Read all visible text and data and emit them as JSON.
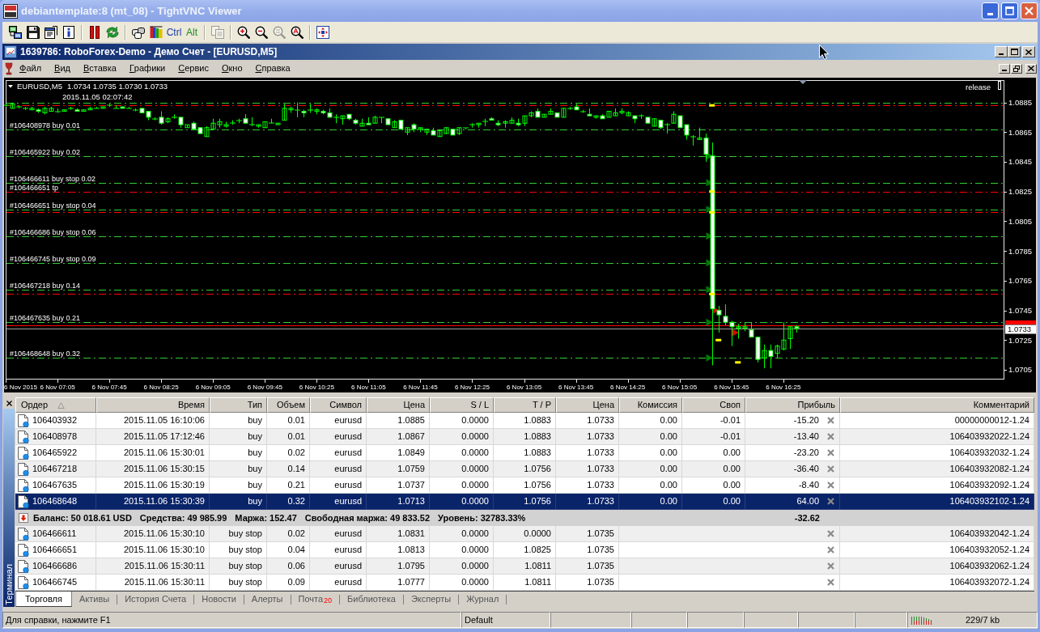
{
  "vnc_window": {
    "title": "debiantemplate:8 (mt_08) - TightVNC Viewer"
  },
  "vnc_toolbar": [
    [
      {
        "disabled": false
      },
      {
        "disabled": false
      },
      {
        "disabled": false
      },
      {
        "disabled": false
      }
    ],
    [
      {
        "disabled": false
      },
      {
        "disabled": false
      }
    ],
    [
      {
        "disabled": false
      },
      {
        "disabled": false
      },
      {
        "label": "Ctrl",
        "color": "#1a3ca8"
      },
      {
        "label": "Alt",
        "color": "#1e8a1e"
      }
    ],
    [
      {
        "disabled": true
      }
    ],
    [
      {
        "disabled": false
      },
      {
        "disabled": false
      },
      {
        "disabled": true
      },
      {
        "disabled": false
      }
    ],
    [
      {
        "disabled": false
      }
    ]
  ],
  "mt4_window": {
    "title": "1639786: RoboForex-Demo - Демо Счет - [EURUSD,M5]"
  },
  "menu": [
    "Файл",
    "Вид",
    "Вставка",
    "Графики",
    "Сервис",
    "Окно",
    "Справка"
  ],
  "chart": {
    "symbol": "EURUSD,M5",
    "quote": "1.0734 1.0735 1.0730 1.0733",
    "info": "2015.11.05 02:07:42",
    "expert": "release",
    "chart_data": {
      "type": "candlestick",
      "color": "#00ff00",
      "x": [
        "2015-11-06T06:25",
        "2015-11-06T06:30",
        "2015-11-06T06:35",
        "2015-11-06T06:40",
        "2015-11-06T06:45",
        "2015-11-06T06:50",
        "2015-11-06T06:55",
        "2015-11-06T07:00",
        "2015-11-06T07:05",
        "2015-11-06T07:10",
        "2015-11-06T07:15",
        "2015-11-06T07:20",
        "2015-11-06T07:25",
        "2015-11-06T07:30",
        "2015-11-06T07:35",
        "2015-11-06T07:40",
        "2015-11-06T07:45",
        "2015-11-06T07:50",
        "2015-11-06T07:55",
        "2015-11-06T08:00",
        "2015-11-06T08:05",
        "2015-11-06T08:10",
        "2015-11-06T08:15",
        "2015-11-06T08:20",
        "2015-11-06T08:25",
        "2015-11-06T08:30",
        "2015-11-06T08:35",
        "2015-11-06T08:40",
        "2015-11-06T08:45",
        "2015-11-06T08:50",
        "2015-11-06T08:55",
        "2015-11-06T09:00",
        "2015-11-06T09:05",
        "2015-11-06T09:10",
        "2015-11-06T09:15",
        "2015-11-06T09:20",
        "2015-11-06T09:25",
        "2015-11-06T09:30",
        "2015-11-06T09:35",
        "2015-11-06T09:40",
        "2015-11-06T09:45",
        "2015-11-06T09:50",
        "2015-11-06T09:55",
        "2015-11-06T10:00",
        "2015-11-06T10:05",
        "2015-11-06T10:10",
        "2015-11-06T10:15",
        "2015-11-06T10:20",
        "2015-11-06T10:25",
        "2015-11-06T10:30",
        "2015-11-06T10:35",
        "2015-11-06T10:40",
        "2015-11-06T10:45",
        "2015-11-06T10:50",
        "2015-11-06T10:55",
        "2015-11-06T11:00",
        "2015-11-06T11:05",
        "2015-11-06T11:10",
        "2015-11-06T11:15",
        "2015-11-06T11:20",
        "2015-11-06T11:25",
        "2015-11-06T11:30",
        "2015-11-06T11:35",
        "2015-11-06T11:40",
        "2015-11-06T11:45",
        "2015-11-06T11:50",
        "2015-11-06T11:55",
        "2015-11-06T12:00",
        "2015-11-06T12:05",
        "2015-11-06T12:10",
        "2015-11-06T12:15",
        "2015-11-06T12:20",
        "2015-11-06T12:25",
        "2015-11-06T12:30",
        "2015-11-06T12:35",
        "2015-11-06T12:40",
        "2015-11-06T12:45",
        "2015-11-06T12:50",
        "2015-11-06T12:55",
        "2015-11-06T13:00",
        "2015-11-06T13:05",
        "2015-11-06T13:10",
        "2015-11-06T13:15",
        "2015-11-06T13:20",
        "2015-11-06T13:25",
        "2015-11-06T13:30",
        "2015-11-06T13:35",
        "2015-11-06T13:40",
        "2015-11-06T13:45",
        "2015-11-06T13:50",
        "2015-11-06T13:55",
        "2015-11-06T14:00",
        "2015-11-06T14:05",
        "2015-11-06T14:10",
        "2015-11-06T14:15",
        "2015-11-06T14:20",
        "2015-11-06T14:25",
        "2015-11-06T14:30",
        "2015-11-06T14:35",
        "2015-11-06T14:40",
        "2015-11-06T14:45",
        "2015-11-06T14:50",
        "2015-11-06T14:55",
        "2015-11-06T15:00",
        "2015-11-06T15:05",
        "2015-11-06T15:10",
        "2015-11-06T15:15",
        "2015-11-06T15:20",
        "2015-11-06T15:25",
        "2015-11-06T15:30",
        "2015-11-06T15:35",
        "2015-11-06T15:40",
        "2015-11-06T15:45",
        "2015-11-06T15:50",
        "2015-11-06T15:55",
        "2015-11-06T16:00",
        "2015-11-06T16:05",
        "2015-11-06T16:10",
        "2015-11-06T16:15",
        "2015-11-06T16:20",
        "2015-11-06T16:25",
        "2015-11-06T16:30",
        "2015-11-06T16:35"
      ],
      "ohlc": [
        [
          1.0883,
          1.0884,
          1.0882,
          1.0883
        ],
        [
          1.0881,
          1.0885,
          1.0881,
          1.0884
        ],
        [
          1.0882,
          1.0883,
          1.0881,
          1.0882
        ],
        [
          1.0881,
          1.0882,
          1.088,
          1.0881
        ],
        [
          1.088,
          1.0882,
          1.088,
          1.0881
        ],
        [
          1.088,
          1.0881,
          1.0878,
          1.0879
        ],
        [
          1.0878,
          1.0882,
          1.0877,
          1.0881
        ],
        [
          1.0879,
          1.0882,
          1.0879,
          1.0881
        ],
        [
          1.0879,
          1.0881,
          1.0878,
          1.0879
        ],
        [
          1.0879,
          1.088,
          1.0879,
          1.088
        ],
        [
          1.0881,
          1.0882,
          1.088,
          1.0881
        ],
        [
          1.088,
          1.0881,
          1.0879,
          1.0879
        ],
        [
          1.0879,
          1.088,
          1.0879,
          1.088
        ],
        [
          1.088,
          1.0882,
          1.088,
          1.0881
        ],
        [
          1.0881,
          1.0882,
          1.0881,
          1.0881
        ],
        [
          1.0881,
          1.0882,
          1.0881,
          1.0882
        ],
        [
          1.0883,
          1.0884,
          1.0882,
          1.0883
        ],
        [
          1.0881,
          1.0883,
          1.0881,
          1.0881
        ],
        [
          1.0882,
          1.0882,
          1.0881,
          1.0881
        ],
        [
          1.0881,
          1.0882,
          1.0881,
          1.0881
        ],
        [
          1.088,
          1.0881,
          1.0879,
          1.088
        ],
        [
          1.0881,
          1.0881,
          1.0878,
          1.0878
        ],
        [
          1.0879,
          1.0879,
          1.0873,
          1.0875
        ],
        [
          1.0874,
          1.0875,
          1.0873,
          1.0874
        ],
        [
          1.0875,
          1.0879,
          1.087,
          1.0871
        ],
        [
          1.0872,
          1.0875,
          1.0871,
          1.0874
        ],
        [
          1.0875,
          1.0877,
          1.0874,
          1.0875
        ],
        [
          1.0875,
          1.0875,
          1.0868,
          1.087
        ],
        [
          1.0868,
          1.087,
          1.0868,
          1.087
        ],
        [
          1.0871,
          1.0872,
          1.0867,
          1.0867
        ],
        [
          1.0868,
          1.0868,
          1.0864,
          1.0864
        ],
        [
          1.0862,
          1.0869,
          1.0862,
          1.0868
        ],
        [
          1.0867,
          1.0874,
          1.0867,
          1.0871
        ],
        [
          1.087,
          1.0874,
          1.0868,
          1.0872
        ],
        [
          1.0869,
          1.0872,
          1.0868,
          1.087
        ],
        [
          1.0871,
          1.0873,
          1.087,
          1.0871
        ],
        [
          1.0873,
          1.0874,
          1.0871,
          1.0873
        ],
        [
          1.0874,
          1.0877,
          1.0871,
          1.0871
        ],
        [
          1.087,
          1.0875,
          1.0869,
          1.087
        ],
        [
          1.0869,
          1.087,
          1.0868,
          1.087
        ],
        [
          1.0868,
          1.0872,
          1.0868,
          1.0872
        ],
        [
          1.0871,
          1.0874,
          1.0871,
          1.0871
        ],
        [
          1.087,
          1.0871,
          1.087,
          1.0871
        ],
        [
          1.0873,
          1.0884,
          1.0873,
          1.0881
        ],
        [
          1.088,
          1.0882,
          1.0878,
          1.0881
        ],
        [
          1.088,
          1.0885,
          1.0875,
          1.088
        ],
        [
          1.0879,
          1.088,
          1.0875,
          1.0878
        ],
        [
          1.088,
          1.0884,
          1.0878,
          1.088
        ],
        [
          1.0879,
          1.0881,
          1.0877,
          1.088
        ],
        [
          1.0879,
          1.088,
          1.0877,
          1.0878
        ],
        [
          1.0878,
          1.0881,
          1.0875,
          1.0875
        ],
        [
          1.0875,
          1.0877,
          1.0871,
          1.0875
        ],
        [
          1.0874,
          1.0876,
          1.087,
          1.0876
        ],
        [
          1.0877,
          1.0877,
          1.0873,
          1.0874
        ],
        [
          1.0873,
          1.0874,
          1.087,
          1.0871
        ],
        [
          1.0869,
          1.0874,
          1.0869,
          1.0871
        ],
        [
          1.0871,
          1.0875,
          1.087,
          1.087
        ],
        [
          1.0871,
          1.0876,
          1.0871,
          1.0875
        ],
        [
          1.0875,
          1.0875,
          1.0871,
          1.0875
        ],
        [
          1.0874,
          1.0874,
          1.087,
          1.087
        ],
        [
          1.0868,
          1.0873,
          1.0868,
          1.0872
        ],
        [
          1.0873,
          1.0873,
          1.0867,
          1.0867
        ],
        [
          1.0865,
          1.0868,
          1.0863,
          1.0868
        ],
        [
          1.087,
          1.0871,
          1.0865,
          1.0867
        ],
        [
          1.0867,
          1.0868,
          1.0865,
          1.0868
        ],
        [
          1.0865,
          1.0867,
          1.0863,
          1.0867
        ],
        [
          1.0866,
          1.0868,
          1.0863,
          1.0863
        ],
        [
          1.0862,
          1.0867,
          1.0862,
          1.0866
        ],
        [
          1.0864,
          1.0868,
          1.0864,
          1.0868
        ],
        [
          1.0867,
          1.0867,
          1.0863,
          1.0863
        ],
        [
          1.0864,
          1.0868,
          1.0863,
          1.0868
        ],
        [
          1.0868,
          1.0868,
          1.0867,
          1.0868
        ],
        [
          1.087,
          1.0871,
          1.0868,
          1.087
        ],
        [
          1.087,
          1.0871,
          1.0868,
          1.0871
        ],
        [
          1.0872,
          1.0874,
          1.0869,
          1.0872
        ],
        [
          1.0874,
          1.0875,
          1.0873,
          1.0873
        ],
        [
          1.0871,
          1.0873,
          1.0869,
          1.087
        ],
        [
          1.0871,
          1.0873,
          1.0868,
          1.0872
        ],
        [
          1.0871,
          1.0875,
          1.0871,
          1.0873
        ],
        [
          1.0871,
          1.0874,
          1.0869,
          1.087
        ],
        [
          1.0871,
          1.0876,
          1.0869,
          1.0876
        ],
        [
          1.0876,
          1.0879,
          1.0875,
          1.0878
        ],
        [
          1.0879,
          1.0881,
          1.0875,
          1.0875
        ],
        [
          1.0875,
          1.0877,
          1.0875,
          1.0877
        ],
        [
          1.0877,
          1.0881,
          1.0877,
          1.0879
        ],
        [
          1.0878,
          1.0878,
          1.0875,
          1.0875
        ],
        [
          1.0875,
          1.0881,
          1.0875,
          1.0881
        ],
        [
          1.0881,
          1.0882,
          1.088,
          1.0881
        ],
        [
          1.0882,
          1.0884,
          1.088,
          1.088
        ],
        [
          1.0879,
          1.088,
          1.0878,
          1.0879
        ],
        [
          1.0877,
          1.0881,
          1.0876,
          1.0876
        ],
        [
          1.0875,
          1.0876,
          1.0874,
          1.0876
        ],
        [
          1.0876,
          1.0877,
          1.0874,
          1.0874
        ],
        [
          1.0875,
          1.0879,
          1.0875,
          1.0879
        ],
        [
          1.0876,
          1.0881,
          1.0876,
          1.0878
        ],
        [
          1.0878,
          1.0881,
          1.0877,
          1.0879
        ],
        [
          1.0876,
          1.0879,
          1.0876,
          1.0878
        ],
        [
          1.0876,
          1.0876,
          1.0871,
          1.0874
        ],
        [
          1.0876,
          1.0877,
          1.0874,
          1.0876
        ],
        [
          1.0875,
          1.0875,
          1.0871,
          1.0871
        ],
        [
          1.0869,
          1.0874,
          1.0869,
          1.0874
        ],
        [
          1.0873,
          1.0873,
          1.0867,
          1.0868
        ],
        [
          1.087,
          1.0871,
          1.0864,
          1.087
        ],
        [
          1.0871,
          1.0879,
          1.0871,
          1.0877
        ],
        [
          1.0876,
          1.0876,
          1.0868,
          1.0868
        ],
        [
          1.087,
          1.087,
          1.086,
          1.0863
        ],
        [
          1.0862,
          1.0863,
          1.0856,
          1.0862
        ],
        [
          1.086,
          1.0868,
          1.086,
          1.0861
        ],
        [
          1.0861,
          1.0864,
          1.0845,
          1.085
        ],
        [
          1.0849,
          1.0858,
          1.0708,
          1.0746
        ],
        [
          1.0745,
          1.0748,
          1.073,
          1.0742
        ],
        [
          1.0741,
          1.0749,
          1.0735,
          1.0737
        ],
        [
          1.0737,
          1.0738,
          1.0721,
          1.0734
        ],
        [
          1.0733,
          1.0736,
          1.0726,
          1.0734
        ],
        [
          1.0733,
          1.0737,
          1.0731,
          1.0734
        ],
        [
          1.0732,
          1.0737,
          1.0727,
          1.0727
        ],
        [
          1.0727,
          1.0727,
          1.071,
          1.0712
        ],
        [
          1.0713,
          1.0722,
          1.0706,
          1.0718
        ],
        [
          1.0718,
          1.0722,
          1.0706,
          1.0714
        ],
        [
          1.0716,
          1.0722,
          1.0713,
          1.0721
        ],
        [
          1.0719,
          1.0737,
          1.0718,
          1.0725
        ],
        [
          1.0726,
          1.0734,
          1.0719,
          1.0734
        ],
        [
          1.0734,
          1.0735,
          1.073,
          1.0733
        ]
      ],
      "series": [
        {
          "type": "scatter",
          "marker": "triangle",
          "color": "#007a00",
          "x": [
            "2015-11-06T15:28",
            "2015-11-06T15:28",
            "2015-11-06T15:28",
            "2015-11-06T15:28",
            "2015-11-06T15:28",
            "2015-11-06T15:28",
            "2015-11-06T15:28",
            "2015-11-06T15:28"
          ],
          "values": [
            1.0849,
            1.0831,
            1.0813,
            1.0795,
            1.0777,
            1.0759,
            1.0737,
            1.0713
          ]
        },
        {
          "type": "scatter",
          "marker": "triangle",
          "color": "#e00000",
          "x": [
            "2015-11-06T15:33",
            "2015-11-06T15:48"
          ],
          "values": [
            1.0745,
            1.073
          ]
        },
        {
          "type": "scatter",
          "marker": "square",
          "color": "#ffff00",
          "x": [
            "2015-11-06T15:30",
            "2015-11-06T15:30",
            "2015-11-06T15:30",
            "2015-11-06T15:30",
            "2015-11-06T15:35",
            "2015-11-06T15:50"
          ],
          "values": [
            1.0883,
            1.0825,
            1.0811,
            1.0756,
            1.0725,
            1.071
          ]
        }
      ],
      "xlim": [
        "2015-11-06T06:25",
        "2015-11-06T19:15"
      ],
      "ylim": [
        1.0699,
        1.09
      ],
      "xticks": [
        {
          "value": "2015-11-06T06:25",
          "label": "6 Nov 2015"
        },
        {
          "value": "2015-11-06T07:05",
          "label": "6 Nov 07:05"
        },
        {
          "value": "2015-11-06T07:45",
          "label": "6 Nov 07:45"
        },
        {
          "value": "2015-11-06T08:25",
          "label": "6 Nov 08:25"
        },
        {
          "value": "2015-11-06T09:05",
          "label": "6 Nov 09:05"
        },
        {
          "value": "2015-11-06T09:45",
          "label": "6 Nov 09:45"
        },
        {
          "value": "2015-11-06T10:25",
          "label": "6 Nov 10:25"
        },
        {
          "value": "2015-11-06T11:05",
          "label": "6 Nov 11:05"
        },
        {
          "value": "2015-11-06T11:45",
          "label": "6 Nov 11:45"
        },
        {
          "value": "2015-11-06T12:25",
          "label": "6 Nov 12:25"
        },
        {
          "value": "2015-11-06T13:05",
          "label": "6 Nov 13:05"
        },
        {
          "value": "2015-11-06T13:45",
          "label": "6 Nov 13:45"
        },
        {
          "value": "2015-11-06T14:25",
          "label": "6 Nov 14:25"
        },
        {
          "value": "2015-11-06T15:05",
          "label": "6 Nov 15:05"
        },
        {
          "value": "2015-11-06T15:45",
          "label": "6 Nov 15:45"
        },
        {
          "value": "2015-11-06T16:25",
          "label": "6 Nov 16:25"
        }
      ],
      "yticks": [
        1.0885,
        1.0865,
        1.0845,
        1.0825,
        1.0805,
        1.0785,
        1.0765,
        1.0745,
        1.0725,
        1.0705
      ],
      "ref_lines": [
        {
          "axis": "y",
          "value": 1.0885,
          "color": "#32cd32",
          "line_style": "dashdot"
        },
        {
          "axis": "y",
          "value": 1.0883,
          "color": "#ff0000",
          "line_style": "dashdot"
        },
        {
          "axis": "y",
          "value": 1.0867,
          "label": "#106408978 buy 0.01",
          "color": "#32cd32",
          "line_style": "dashdot"
        },
        {
          "axis": "y",
          "value": 1.0849,
          "label": "#106465922 buy 0.02",
          "color": "#32cd32",
          "line_style": "dashdot"
        },
        {
          "axis": "y",
          "value": 1.0831,
          "label": "#106466611 buy stop 0.02",
          "color": "#32cd32",
          "line_style": "dashdot"
        },
        {
          "axis": "y",
          "value": 1.0825,
          "label": "#106466651 tp",
          "color": "#ff0000",
          "line_style": "dashdot"
        },
        {
          "axis": "y",
          "value": 1.0813,
          "label": "#106466651 buy stop 0.04",
          "color": "#32cd32",
          "line_style": "dashdot"
        },
        {
          "axis": "y",
          "value": 1.0811,
          "color": "#ff0000",
          "line_style": "dashdot"
        },
        {
          "axis": "y",
          "value": 1.0795,
          "label": "#106466686 buy stop 0.06",
          "color": "#32cd32",
          "line_style": "dashdot"
        },
        {
          "axis": "y",
          "value": 1.0777,
          "label": "#106466745 buy stop 0.09",
          "color": "#32cd32",
          "line_style": "dashdot"
        },
        {
          "axis": "y",
          "value": 1.0759,
          "label": "#106467218 buy 0.14",
          "color": "#32cd32",
          "line_style": "dashdot"
        },
        {
          "axis": "y",
          "value": 1.0756,
          "color": "#ff0000",
          "line_style": "dashdot"
        },
        {
          "axis": "y",
          "value": 1.0737,
          "label": "#106467635 buy 0.21",
          "color": "#32cd32",
          "line_style": "dashdot"
        },
        {
          "axis": "y",
          "value": 1.0735,
          "color": "#ff0000",
          "line_style": "solid"
        },
        {
          "axis": "y",
          "value": 1.0733,
          "label": "1.0733",
          "color": "#a0a0a0",
          "line_style": "solid"
        },
        {
          "axis": "y",
          "value": 1.0713,
          "label": "#106468648 buy 0.32",
          "color": "#32cd32",
          "line_style": "dashdot"
        }
      ]
    }
  },
  "terminal": {
    "title": "Терминал",
    "columns": [
      {
        "label": "Ордер",
        "sorted": true
      },
      {
        "label": "Время",
        "sorted": false
      },
      {
        "label": "Тип",
        "sorted": false
      },
      {
        "label": "Объем",
        "sorted": false
      },
      {
        "label": "Символ",
        "sorted": false
      },
      {
        "label": "Цена",
        "sorted": false
      },
      {
        "label": "S / L",
        "sorted": false
      },
      {
        "label": "T / P",
        "sorted": false
      },
      {
        "label": "Цена",
        "sorted": false
      },
      {
        "label": "Комиссия",
        "sorted": false
      },
      {
        "label": "Своп",
        "sorted": false
      },
      {
        "label": "Прибыль",
        "sorted": false
      },
      {
        "label": "Комментарий",
        "sorted": false
      }
    ],
    "positions": [
      {
        "order": "106403932",
        "time": "2015.11.05 16:10:06",
        "type": "buy",
        "volume": "0.01",
        "symbol": "eurusd",
        "price": "1.0885",
        "sl": "0.0000",
        "tp": "1.0883",
        "current_price": "1.0733",
        "commission": "0.00",
        "swap": "-0.01",
        "profit": "-15.20",
        "comment": "00000000012-1.24",
        "selected": false
      },
      {
        "order": "106408978",
        "time": "2015.11.05 17:12:46",
        "type": "buy",
        "volume": "0.01",
        "symbol": "eurusd",
        "price": "1.0867",
        "sl": "0.0000",
        "tp": "1.0883",
        "current_price": "1.0733",
        "commission": "0.00",
        "swap": "-0.01",
        "profit": "-13.40",
        "comment": "106403932022-1.24",
        "selected": false
      },
      {
        "order": "106465922",
        "time": "2015.11.06 15:30:01",
        "type": "buy",
        "volume": "0.02",
        "symbol": "eurusd",
        "price": "1.0849",
        "sl": "0.0000",
        "tp": "1.0883",
        "current_price": "1.0733",
        "commission": "0.00",
        "swap": "0.00",
        "profit": "-23.20",
        "comment": "106403932032-1.24",
        "selected": false
      },
      {
        "order": "106467218",
        "time": "2015.11.06 15:30:15",
        "type": "buy",
        "volume": "0.14",
        "symbol": "eurusd",
        "price": "1.0759",
        "sl": "0.0000",
        "tp": "1.0756",
        "current_price": "1.0733",
        "commission": "0.00",
        "swap": "0.00",
        "profit": "-36.40",
        "comment": "106403932082-1.24",
        "selected": false
      },
      {
        "order": "106467635",
        "time": "2015.11.06 15:30:19",
        "type": "buy",
        "volume": "0.21",
        "symbol": "eurusd",
        "price": "1.0737",
        "sl": "0.0000",
        "tp": "1.0756",
        "current_price": "1.0733",
        "commission": "0.00",
        "swap": "0.00",
        "profit": "-8.40",
        "comment": "106403932092-1.24",
        "selected": false
      },
      {
        "order": "106468648",
        "time": "2015.11.06 15:30:39",
        "type": "buy",
        "volume": "0.32",
        "symbol": "eurusd",
        "price": "1.0713",
        "sl": "0.0000",
        "tp": "1.0756",
        "current_price": "1.0733",
        "commission": "0.00",
        "swap": "0.00",
        "profit": "64.00",
        "comment": "106403932102-1.24",
        "selected": true
      }
    ],
    "summary": {
      "items": [
        "Баланс: 50 018.61 USD",
        "Средства: 49 985.99",
        "Маржа: 152.47",
        "Свободная маржа: 49 833.52",
        "Уровень: 32783.33%"
      ],
      "profit": "-32.62"
    },
    "orders": [
      {
        "order": "106466611",
        "time": "2015.11.06 15:30:10",
        "type": "buy stop",
        "volume": "0.02",
        "symbol": "eurusd",
        "price": "1.0831",
        "sl": "0.0000",
        "tp": "0.0000",
        "current_price": "1.0735",
        "comment": "106403932042-1.24",
        "selected": false
      },
      {
        "order": "106466651",
        "time": "2015.11.06 15:30:10",
        "type": "buy stop",
        "volume": "0.04",
        "symbol": "eurusd",
        "price": "1.0813",
        "sl": "0.0000",
        "tp": "1.0825",
        "current_price": "1.0735",
        "comment": "106403932052-1.24",
        "selected": false
      },
      {
        "order": "106466686",
        "time": "2015.11.06 15:30:11",
        "type": "buy stop",
        "volume": "0.06",
        "symbol": "eurusd",
        "price": "1.0795",
        "sl": "0.0000",
        "tp": "1.0811",
        "current_price": "1.0735",
        "comment": "106403932062-1.24",
        "selected": false
      },
      {
        "order": "106466745",
        "time": "2015.11.06 15:30:11",
        "type": "buy stop",
        "volume": "0.09",
        "symbol": "eurusd",
        "price": "1.0777",
        "sl": "0.0000",
        "tp": "1.0811",
        "current_price": "1.0735",
        "comment": "106403932072-1.24",
        "selected": false
      }
    ],
    "tabs": [
      {
        "label": "Торговля",
        "selected": true
      },
      {
        "label": "Активы",
        "selected": false
      },
      {
        "label": "История Счета",
        "selected": false
      },
      {
        "label": "Новости",
        "selected": false
      },
      {
        "label": "Алерты",
        "selected": false
      },
      {
        "label": "Почта",
        "badge": "20",
        "selected": false
      },
      {
        "label": "Библиотека",
        "selected": false
      },
      {
        "label": "Эксперты",
        "selected": false
      },
      {
        "label": "Журнал",
        "selected": false
      }
    ]
  },
  "status_bar": {
    "help": "Для справки, нажмите F1",
    "profile": "Default",
    "traffic": "229/7 kb"
  }
}
